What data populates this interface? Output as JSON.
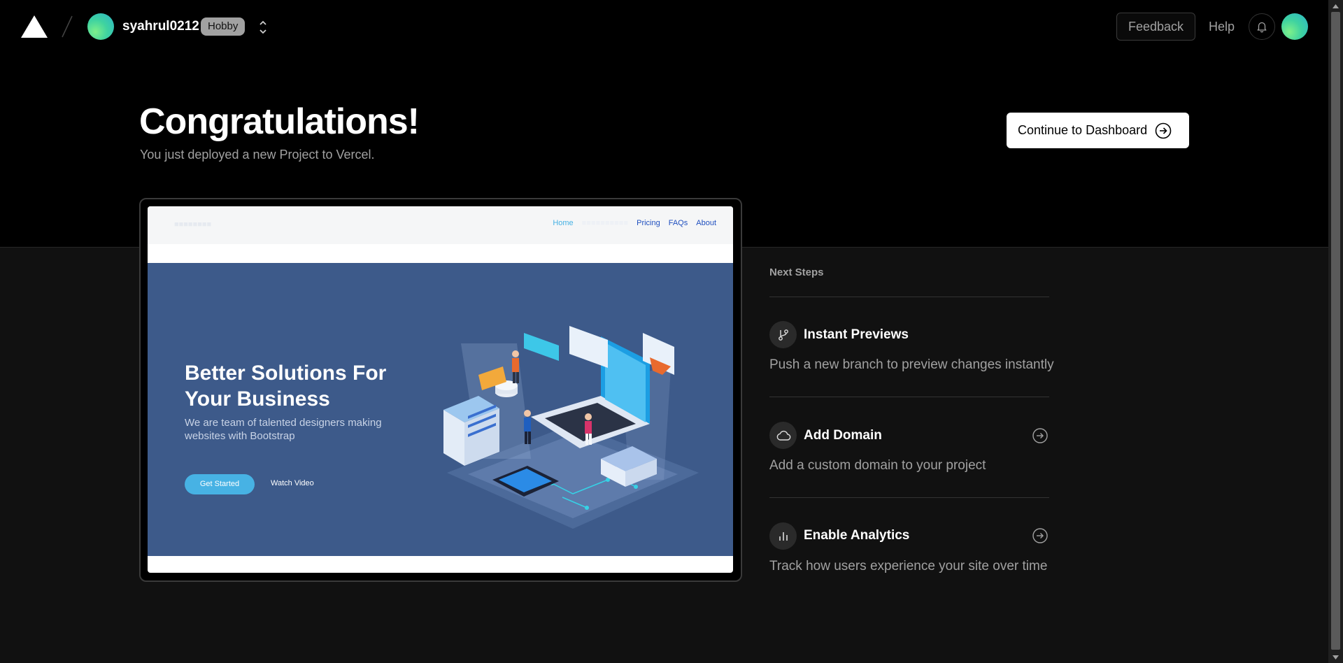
{
  "header": {
    "team_name": "syahrul0212",
    "plan_badge": "Hobby",
    "feedback_label": "Feedback",
    "help_label": "Help"
  },
  "hero": {
    "title": "Congratulations!",
    "subtitle": "You just deployed a new Project to Vercel.",
    "continue_label": "Continue to Dashboard"
  },
  "preview_site": {
    "nav_links": [
      "Home",
      "Pricing",
      "FAQs",
      "About"
    ],
    "headline": "Better Solutions For Your Business",
    "tagline": "We are team of talented designers making websites with Bootstrap",
    "primary_button": "Get Started",
    "secondary_link": "Watch Video"
  },
  "next_steps": {
    "title": "Next Steps",
    "items": [
      {
        "title": "Instant Previews",
        "description": "Push a new branch to preview changes instantly",
        "icon": "git-branch-icon"
      },
      {
        "title": "Add Domain",
        "description": "Add a custom domain to your project",
        "icon": "cloud-icon"
      },
      {
        "title": "Enable Analytics",
        "description": "Track how users experience your site over time",
        "icon": "bar-chart-icon"
      }
    ]
  },
  "colors": {
    "page_top": "#000000",
    "page_bottom": "#111111",
    "accent_avatar": "#3fd3a0",
    "preview_hero": "#3d5a8a",
    "preview_button": "#47b2e4"
  }
}
